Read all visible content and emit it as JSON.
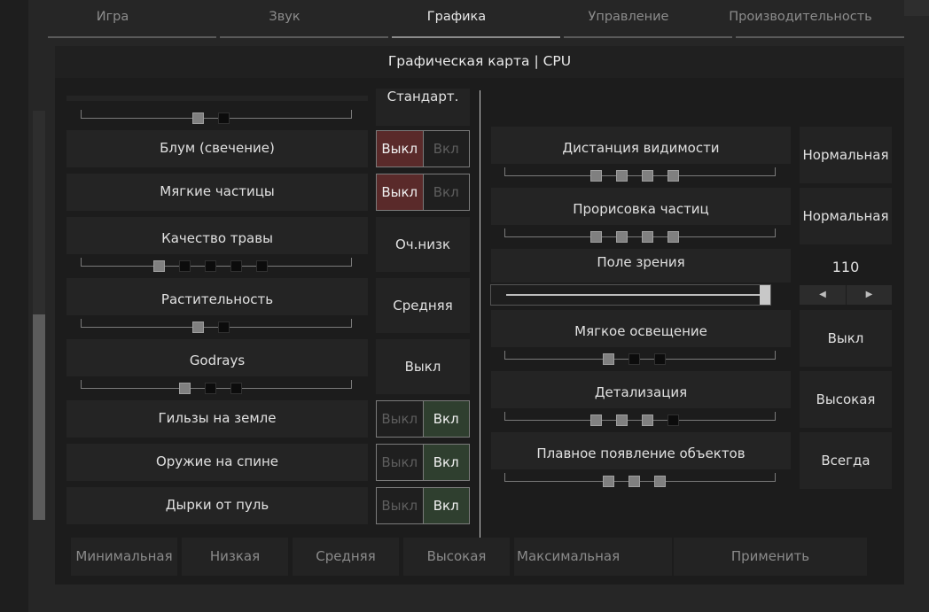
{
  "tabs": [
    {
      "label": "Игра"
    },
    {
      "label": "Звук"
    },
    {
      "label": "Графика"
    },
    {
      "label": "Управление"
    },
    {
      "label": "Производительность"
    }
  ],
  "subtitle": "Графическая карта | CPU",
  "left": {
    "partial_value": "Стандарт.",
    "bloom": {
      "label": "Блум (свечение)",
      "off": "Выкл",
      "on": "Вкл"
    },
    "soft_particles": {
      "label": "Мягкие частицы",
      "off": "Выкл",
      "on": "Вкл"
    },
    "grass": {
      "label": "Качество травы",
      "value": "Оч.низк"
    },
    "vegetation": {
      "label": "Растительность",
      "value": "Средняя"
    },
    "godrays": {
      "label": "Godrays",
      "value": "Выкл"
    },
    "shells": {
      "label": "Гильзы на земле",
      "off": "Выкл",
      "on": "Вкл"
    },
    "weapon_back": {
      "label": "Оружие на спине",
      "off": "Выкл",
      "on": "Вкл"
    },
    "bullet_holes": {
      "label": "Дырки от пуль",
      "off": "Выкл",
      "on": "Вкл"
    }
  },
  "right": {
    "view_distance": {
      "label": "Дистанция видимости",
      "value": "Нормальная"
    },
    "particle_draw": {
      "label": "Прорисовка частиц",
      "value": "Нормальная"
    },
    "fov": {
      "label": "Поле зрения",
      "value": "110",
      "dec_icon": "◀",
      "inc_icon": "▶"
    },
    "soft_light": {
      "label": "Мягкое освещение",
      "value": "Выкл"
    },
    "detail": {
      "label": "Детализация",
      "value": "Высокая"
    },
    "fade_in": {
      "label": "Плавное появление объектов",
      "value": "Всегда"
    }
  },
  "presets": {
    "minimal": "Минимальная",
    "low": "Низкая",
    "medium": "Средняя",
    "high": "Высокая",
    "max": "Максимальная",
    "apply": "Применить"
  },
  "colors": {
    "toggle_red": "#5a2a2a",
    "toggle_green": "#2f3f2f",
    "background": "#262626"
  }
}
